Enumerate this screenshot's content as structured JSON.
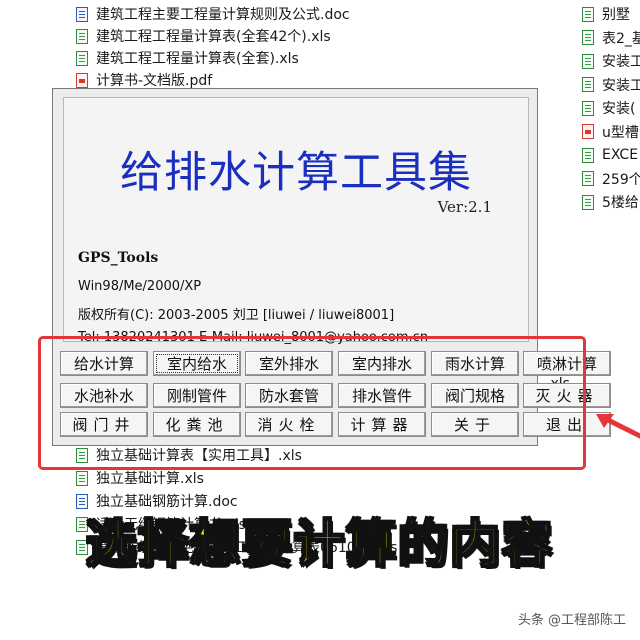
{
  "file_list_left": [
    {
      "name": "建筑工程主要工程量计算规则及公式.doc",
      "type": "doc"
    },
    {
      "name": "建筑工程工程量计算表(全套42个).xls",
      "type": "xls"
    },
    {
      "name": "建筑工程工程量计算表(全套).xls",
      "type": "xls"
    },
    {
      "name": "计算书-文档版.pdf",
      "type": "pdf"
    }
  ],
  "file_list_left_bottom": [
    {
      "name": "独立基础计算表【实用工具】.xls",
      "type": "xls"
    },
    {
      "name": "独立基础计算.xls",
      "type": "xls"
    },
    {
      "name": "独立基础钢筋计算.doc",
      "type": "doc"
    },
    {
      "name": "适用无缝钢管计算书.xls",
      "type": "xls"
    },
    {
      "name": "常用无缝钢管绝热刷油工程量计算表061012.xls",
      "type": "xls"
    }
  ],
  "file_list_right": [
    {
      "name": "别墅",
      "type": "xls"
    },
    {
      "name": "表2_基",
      "type": "xls"
    },
    {
      "name": "安装工",
      "type": "xls"
    },
    {
      "name": "安装工",
      "type": "xls"
    },
    {
      "name": "安装(",
      "type": "xls"
    },
    {
      "name": "u型槽",
      "type": "pdf"
    },
    {
      "name": "EXCE",
      "type": "xls"
    },
    {
      "name": "259个",
      "type": "xls"
    },
    {
      "name": "5楼给",
      "type": "xls"
    }
  ],
  "fragment_xls": ".xls",
  "dialog": {
    "title": "给排水计算工具集",
    "version": "Ver:2.1",
    "tool_name": "GPS_Tools",
    "os": "Win98/Me/2000/XP",
    "copyright": "版权所有(C):  2003-2005  刘卫 [liuwei / liuwei8001]",
    "contact": "Tel:  13820241301    E-Mail:  liuwei_8001@yahoo.com.cn",
    "buttons": [
      [
        "给水计算",
        "室内给水",
        "室外排水",
        "室内排水",
        "雨水计算",
        "喷淋计算"
      ],
      [
        "水池补水",
        "刚制管件",
        "防水套管",
        "排水管件",
        "阀门规格",
        "灭火器"
      ],
      [
        "阀门井",
        "化粪池",
        "消火栓",
        "计算器",
        "关于",
        "退出"
      ]
    ]
  },
  "caption": "选择想要计算的内容",
  "watermark": "头条 @工程部陈工",
  "colors": {
    "highlight": "#e2363a",
    "caption": "#ffea00",
    "title": "#1b2fbf"
  }
}
